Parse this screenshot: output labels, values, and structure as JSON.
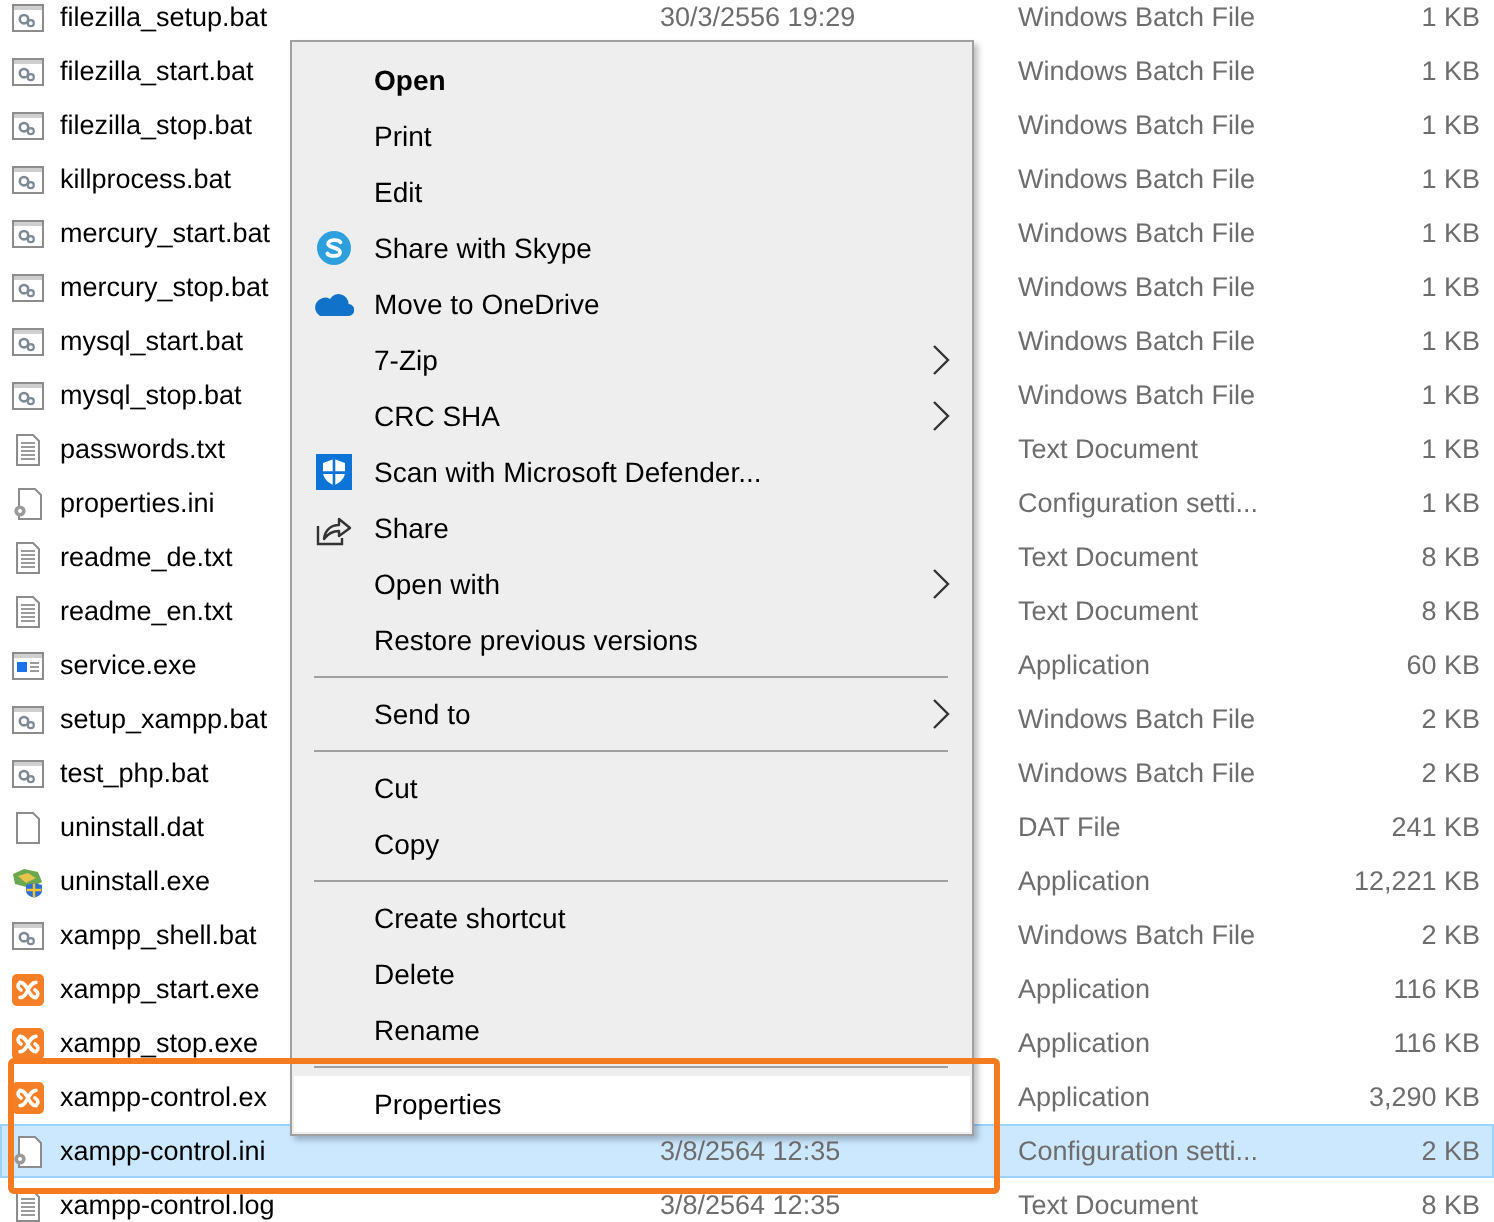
{
  "files": [
    {
      "name": "filezilla_setup.bat",
      "date": "30/3/2556 19:29",
      "type": "Windows Batch File",
      "size": "1 KB",
      "kind": "batch",
      "selected": false
    },
    {
      "name": "filezilla_start.bat",
      "type": "Windows Batch File",
      "size": "1 KB",
      "kind": "batch",
      "selected": false
    },
    {
      "name": "filezilla_stop.bat",
      "type": "Windows Batch File",
      "size": "1 KB",
      "kind": "batch",
      "selected": false
    },
    {
      "name": "killprocess.bat",
      "type": "Windows Batch File",
      "size": "1 KB",
      "kind": "batch",
      "selected": false
    },
    {
      "name": "mercury_start.bat",
      "type": "Windows Batch File",
      "size": "1 KB",
      "kind": "batch",
      "selected": false
    },
    {
      "name": "mercury_stop.bat",
      "type": "Windows Batch File",
      "size": "1 KB",
      "kind": "batch",
      "selected": false
    },
    {
      "name": "mysql_start.bat",
      "type": "Windows Batch File",
      "size": "1 KB",
      "kind": "batch",
      "selected": false
    },
    {
      "name": "mysql_stop.bat",
      "type": "Windows Batch File",
      "size": "1 KB",
      "kind": "batch",
      "selected": false
    },
    {
      "name": "passwords.txt",
      "type": "Text Document",
      "size": "1 KB",
      "kind": "text",
      "selected": false
    },
    {
      "name": "properties.ini",
      "type": "Configuration setti...",
      "size": "1 KB",
      "kind": "config",
      "selected": false
    },
    {
      "name": "readme_de.txt",
      "type": "Text Document",
      "size": "8 KB",
      "kind": "text",
      "selected": false
    },
    {
      "name": "readme_en.txt",
      "type": "Text Document",
      "size": "8 KB",
      "kind": "text",
      "selected": false
    },
    {
      "name": "service.exe",
      "type": "Application",
      "size": "60 KB",
      "kind": "app",
      "selected": false
    },
    {
      "name": "setup_xampp.bat",
      "type": "Windows Batch File",
      "size": "2 KB",
      "kind": "batch",
      "selected": false
    },
    {
      "name": "test_php.bat",
      "type": "Windows Batch File",
      "size": "2 KB",
      "kind": "batch",
      "selected": false
    },
    {
      "name": "uninstall.dat",
      "type": "DAT File",
      "size": "241 KB",
      "kind": "data",
      "selected": false
    },
    {
      "name": "uninstall.exe",
      "type": "Application",
      "size": "12,221 KB",
      "kind": "installer",
      "selected": false
    },
    {
      "name": "xampp_shell.bat",
      "type": "Windows Batch File",
      "size": "2 KB",
      "kind": "batch",
      "selected": false
    },
    {
      "name": "xampp_start.exe",
      "type": "Application",
      "size": "116 KB",
      "kind": "xampp",
      "selected": false
    },
    {
      "name": "xampp_stop.exe",
      "type": "Application",
      "size": "116 KB",
      "kind": "xampp",
      "selected": false
    },
    {
      "name": "xampp-control.ex",
      "type": "Application",
      "size": "3,290 KB",
      "kind": "xampp",
      "selected": false
    },
    {
      "name": "xampp-control.ini",
      "date": "3/8/2564 12:35",
      "type": "Configuration setti...",
      "size": "2 KB",
      "kind": "config",
      "selected": true
    },
    {
      "name": "xampp-control.log",
      "date": "3/8/2564 12:35",
      "type": "Text Document",
      "size": "8 KB",
      "kind": "text",
      "selected": false
    }
  ],
  "context_menu": {
    "groups": [
      [
        {
          "label": "Open",
          "kind": "text",
          "default": true,
          "submenu": false,
          "highlighted": false
        },
        {
          "label": "Print",
          "kind": "text",
          "default": false,
          "submenu": false,
          "highlighted": false
        },
        {
          "label": "Edit",
          "kind": "text",
          "default": false,
          "submenu": false,
          "highlighted": false
        },
        {
          "label": "Share with Skype",
          "kind": "skype",
          "default": false,
          "submenu": false,
          "highlighted": false
        },
        {
          "label": "Move to OneDrive",
          "kind": "onedrive",
          "default": false,
          "submenu": false,
          "highlighted": false
        },
        {
          "label": "7-Zip",
          "kind": "text",
          "default": false,
          "submenu": true,
          "highlighted": false
        },
        {
          "label": "CRC SHA",
          "kind": "text",
          "default": false,
          "submenu": true,
          "highlighted": false
        },
        {
          "label": "Scan with Microsoft Defender...",
          "kind": "defender",
          "default": false,
          "submenu": false,
          "highlighted": false
        },
        {
          "label": "Share",
          "kind": "share",
          "default": false,
          "submenu": false,
          "highlighted": false
        },
        {
          "label": "Open with",
          "kind": "text",
          "default": false,
          "submenu": true,
          "highlighted": false
        },
        {
          "label": "Restore previous versions",
          "kind": "text",
          "default": false,
          "submenu": false,
          "highlighted": false
        }
      ],
      [
        {
          "label": "Send to",
          "kind": "text",
          "default": false,
          "submenu": true,
          "highlighted": false
        }
      ],
      [
        {
          "label": "Cut",
          "kind": "text",
          "default": false,
          "submenu": false,
          "highlighted": false
        },
        {
          "label": "Copy",
          "kind": "text",
          "default": false,
          "submenu": false,
          "highlighted": false
        }
      ],
      [
        {
          "label": "Create shortcut",
          "kind": "text",
          "default": false,
          "submenu": false,
          "highlighted": false
        },
        {
          "label": "Delete",
          "kind": "text",
          "default": false,
          "submenu": false,
          "highlighted": false
        },
        {
          "label": "Rename",
          "kind": "text",
          "default": false,
          "submenu": false,
          "highlighted": false
        }
      ],
      [
        {
          "label": "Properties",
          "kind": "text",
          "default": false,
          "submenu": false,
          "highlighted": true
        }
      ]
    ]
  }
}
